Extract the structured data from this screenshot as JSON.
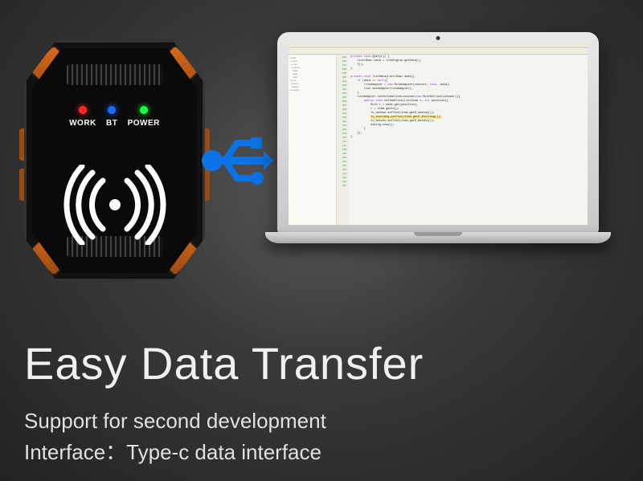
{
  "device": {
    "leds": [
      {
        "color": "red",
        "label": "WORK"
      },
      {
        "color": "blue",
        "label": "BT"
      },
      {
        "color": "green",
        "label": "POWER"
      }
    ],
    "icon": "wireless-icon"
  },
  "connector": {
    "icon": "usb-icon"
  },
  "laptop": {
    "ide": {
      "code_sample": "private void Query(){ [\n    List<Row> data = ruleEngine.getData();\n    f();\n}\n\nprivate void listData(List<Row> data){\n    if (data == null){\n        ruleAdapter = new RuleAdapter(context, this, data);\n        List.setAdapter(ruleAdapter);\n    }\n    ruleAdapter.setOnItemClickListener(new RuleOnClickListener(){\n        public void onItemClick(ListView v, int position){\n            Rule r = data.get(position);\n            r = item.getId();\n            tv_dashua.setText(item.getD_dashua());\n            tv_shuliang.setText(item.getD_shuliang());\n            tv_beizhu.setText(item.getD_beizhu());\n            dialog.show();\n        }\n    });\n}"
    }
  },
  "headline": "Easy Data Transfer",
  "sub1": "Support for second development",
  "sub2_label": "Interface：",
  "sub2_value": "Type-c data interface"
}
